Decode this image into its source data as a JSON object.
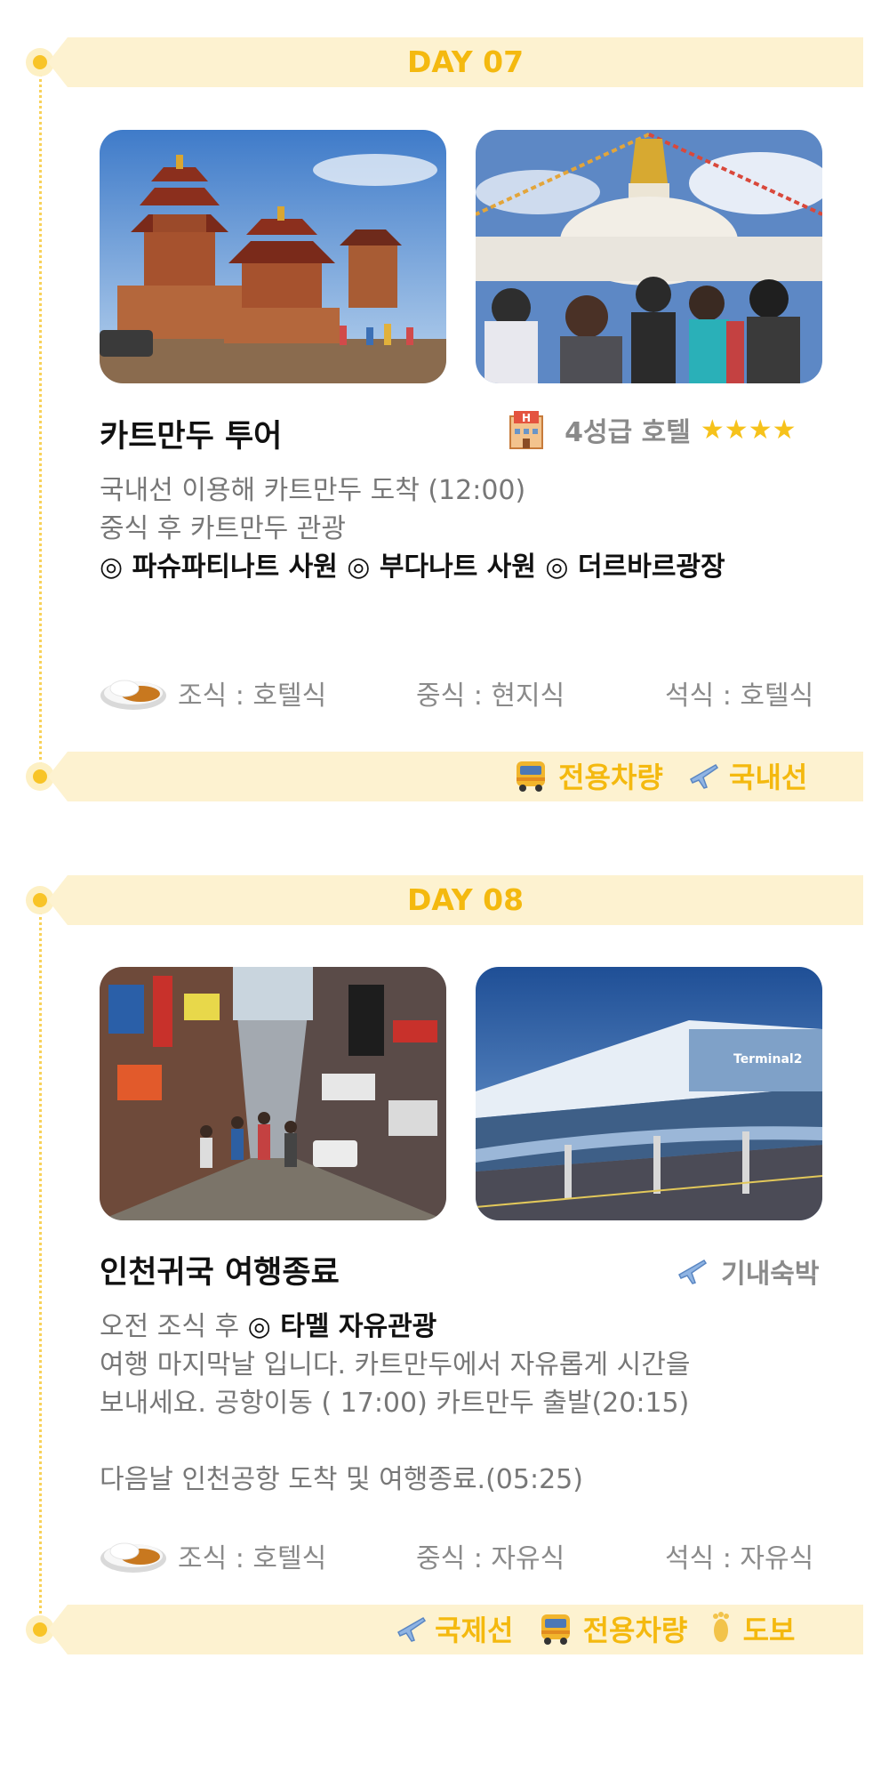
{
  "day7": {
    "day_label": "DAY 07",
    "title": "카트만두 투어",
    "hotel": "4성급 호텔",
    "stars": "★★★★",
    "desc_line1": "국내선 이용해 카트만두 도착 (12:00)",
    "desc_line2": "중식 후 카트만두 관광",
    "desc_line3": "◎ 파슈파티나트 사원 ◎ 부다나트 사원 ◎ 더르바르광장",
    "meal_breakfast": "조식 : 호텔식",
    "meal_lunch": "중식 : 현지식",
    "meal_dinner": "석식 : 호텔식",
    "transport_1": "전용차량",
    "transport_2": "국내선"
  },
  "day8": {
    "day_label": "DAY 08",
    "title": "인천귀국 여행종료",
    "lodging": "기내숙박",
    "desc_line1_prefix": "오전 조식 후 ",
    "desc_line1_strong": "◎ 타멜 자유관광",
    "desc_line2": "여행 마지막날 입니다. 카트만두에서 자유롭게 시간을",
    "desc_line3": "보내세요. 공항이동 ( 17:00) 카트만두 출발(20:15)",
    "desc_line4": "다음날 인천공항 도착 및 여행종료.(05:25)",
    "meal_breakfast": "조식 : 호텔식",
    "meal_lunch": "중식 : 자유식",
    "meal_dinner": "석식 : 자유식",
    "transport_1": "국제선",
    "transport_2": "전용차량",
    "transport_3": "도보",
    "photo_sign": "Terminal2"
  },
  "colors": {
    "accent": "#f4b90f",
    "banner": "#fdf2d0",
    "muted": "#8a8a8a"
  }
}
